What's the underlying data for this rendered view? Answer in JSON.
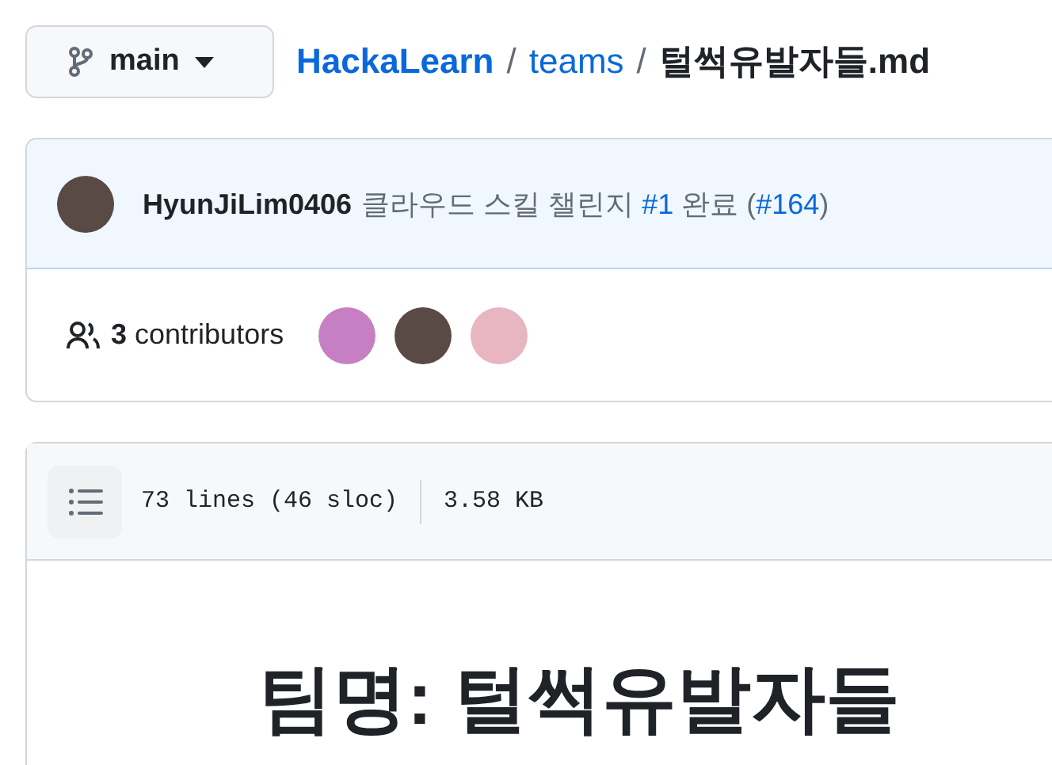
{
  "branch": {
    "name": "main"
  },
  "breadcrumb": {
    "parts": [
      {
        "text": "HackaLearn",
        "kind": "repo",
        "separator": "/"
      },
      {
        "text": "teams",
        "kind": "folder",
        "separator": "/"
      }
    ],
    "file": "털썩유발자들.md"
  },
  "commit": {
    "author": "HyunJiLim0406",
    "message": [
      {
        "text": "클라우드 스킬 챌린지 ",
        "kind": "text"
      },
      {
        "text": "#1",
        "kind": "link"
      },
      {
        "text": " 완료 (",
        "kind": "text"
      },
      {
        "text": "#164",
        "kind": "link"
      },
      {
        "text": ")",
        "kind": "text"
      }
    ]
  },
  "contributors": {
    "count": "3",
    "label": "contributors",
    "avatars": [
      {
        "color": "#c77fc4"
      },
      {
        "color": "#5a4a45"
      },
      {
        "color": "#e8b6c0"
      }
    ]
  },
  "file": {
    "lines": "73 lines (46 sloc)",
    "size": "3.58 KB"
  },
  "content": {
    "heading": "팀명: 털썩유발자들"
  }
}
